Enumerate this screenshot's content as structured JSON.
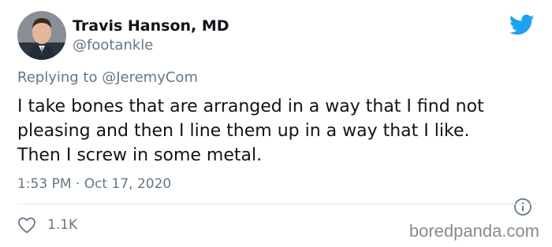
{
  "author": {
    "display_name": "Travis Hanson, MD",
    "handle": "@footankle",
    "avatar_icon": "avatar-photo"
  },
  "brand": {
    "icon": "twitter-bird-icon",
    "color": "#1da1f2"
  },
  "reply": {
    "prefix": "Replying to",
    "mention": "@JeremyCom"
  },
  "tweet": {
    "lines": [
      "I take bones that are arranged in a way that I find not",
      "pleasing and then I line them up in a way that I like.",
      "Then I screw in some metal."
    ],
    "timestamp": "1:53 PM · Oct 17, 2020"
  },
  "actions": {
    "like_icon": "heart-icon",
    "like_count": "1.1K",
    "info_icon": "info-icon"
  },
  "watermark": {
    "text": "boredpanda.com"
  },
  "colors": {
    "text": "#0f1419",
    "secondary": "#657786",
    "divider": "#e1e8ed"
  }
}
